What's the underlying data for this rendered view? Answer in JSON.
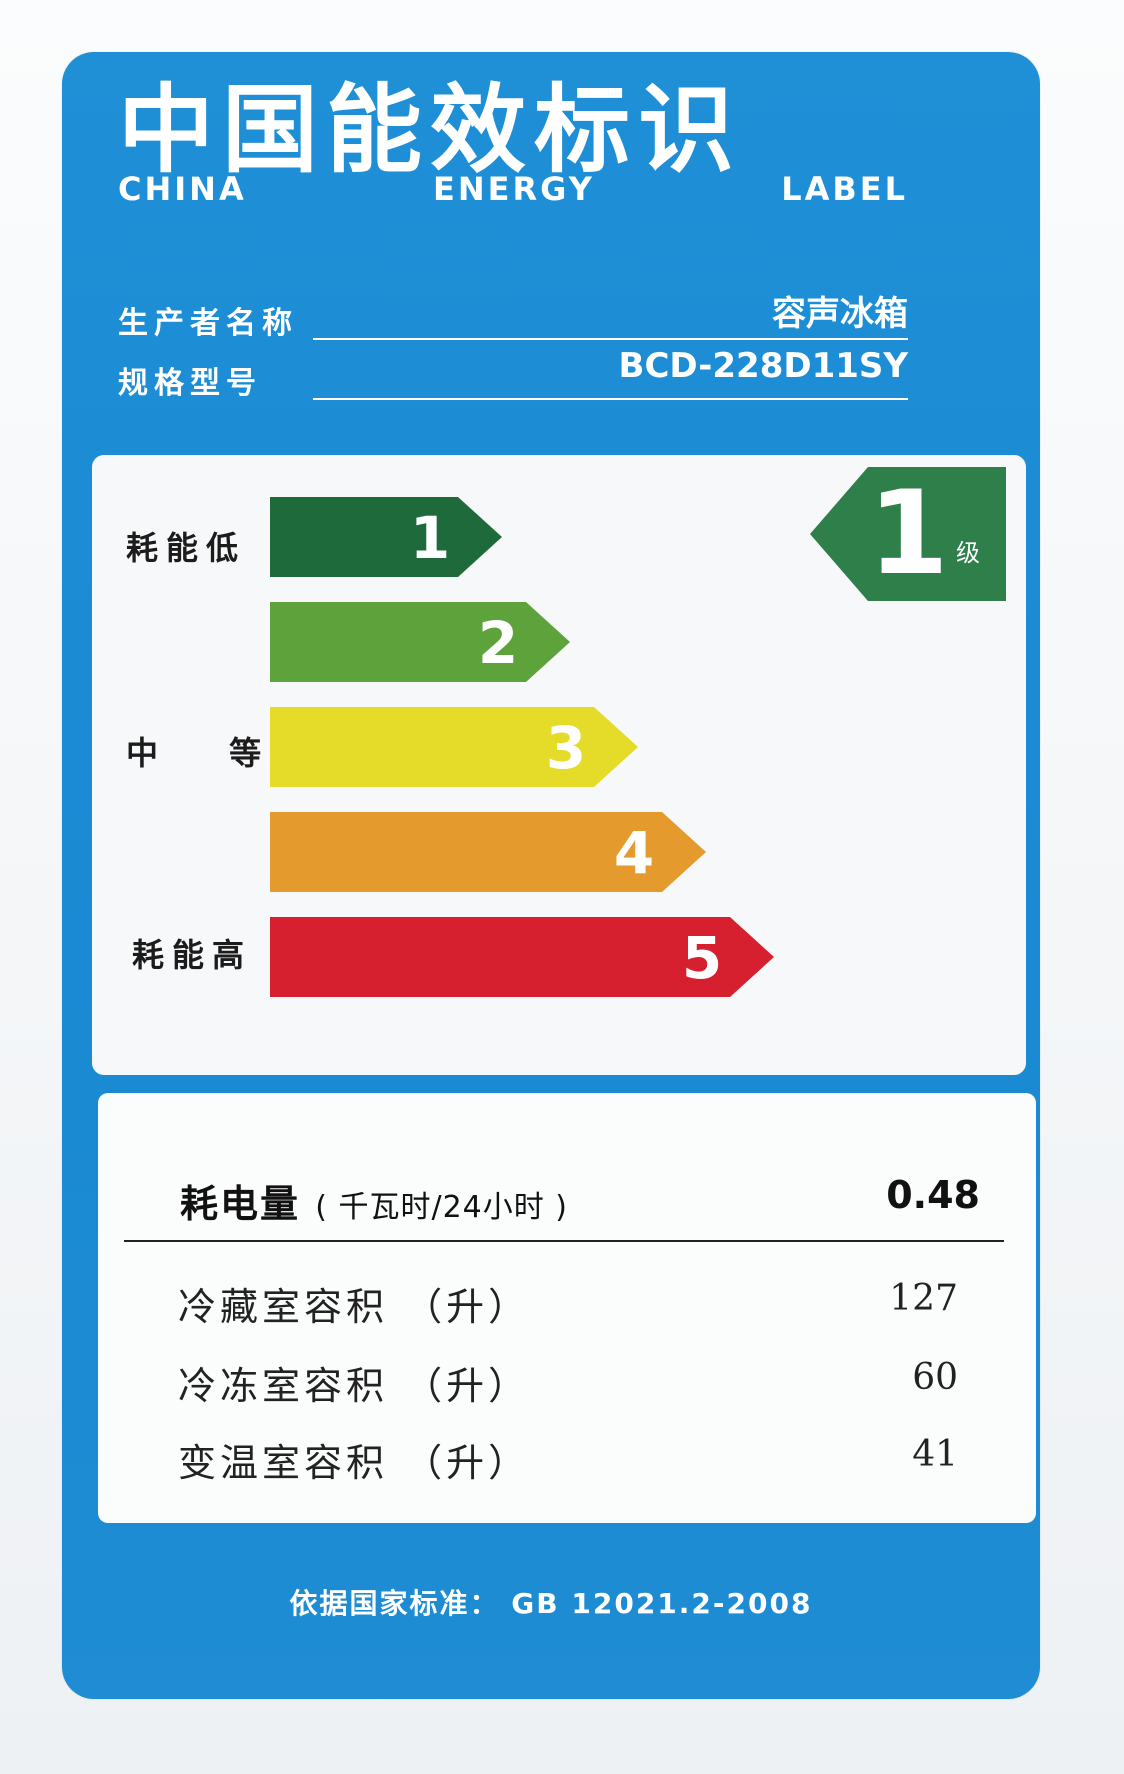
{
  "label": {
    "title_cn": "中国能效标识",
    "title_en_words": [
      "CHINA",
      "ENERGY",
      "LABEL"
    ],
    "manufacturer": {
      "label": "生产者名称",
      "value": "容声冰箱"
    },
    "model": {
      "label": "规格型号",
      "value": "BCD-228D11SY"
    }
  },
  "energy_scale": {
    "side_labels": {
      "low": "耗能低",
      "medium": "中 等",
      "high": "耗能高"
    },
    "grades": [
      {
        "number": "1",
        "color": "#1f6a3b"
      },
      {
        "number": "2",
        "color": "#5da23a"
      },
      {
        "number": "3",
        "color": "#e5dc2a"
      },
      {
        "number": "4",
        "color": "#e59a2d"
      },
      {
        "number": "5",
        "color": "#d61f2f"
      }
    ],
    "current_grade": {
      "number": "1",
      "unit": "级",
      "color": "#2e7f4a"
    }
  },
  "specs": {
    "energy_consumption": {
      "label": "耗电量",
      "unit": "( 千瓦时/24小时 )",
      "value": "0.48"
    },
    "rows": [
      {
        "label": "冷藏室容积 （升）",
        "value": "127"
      },
      {
        "label": "冷冻室容积 （升）",
        "value": "60"
      },
      {
        "label": "变温室容积 （升）",
        "value": "41"
      }
    ]
  },
  "footer": {
    "standard": "依据国家标准：  GB 12021.2-2008"
  }
}
